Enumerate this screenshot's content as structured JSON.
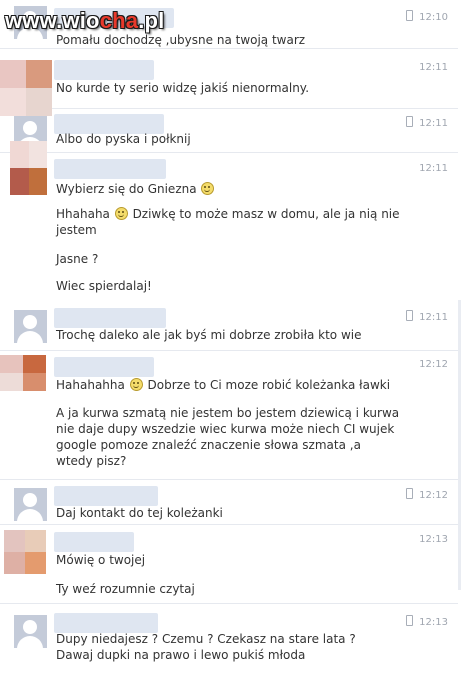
{
  "watermark": {
    "prefix": "www.wio",
    "accent": "cha",
    "suffix": ".pl"
  },
  "messages": [
    {
      "time": "12:10",
      "lines": [
        "Pomału dochodzę ,ubysne na twoją twarz"
      ]
    },
    {
      "time": "12:11",
      "lines": [
        "No kurde ty serio widzę jakiś nienormalny."
      ]
    },
    {
      "time": "12:11",
      "lines": [
        "Albo do pyska i połknij"
      ]
    },
    {
      "time": "12:11",
      "lines": [
        "Wybierz się do Gniezna",
        "Hhahaha",
        "Dziwkę to może masz w domu, ale ja nią nie jestem",
        "Jasne ?",
        "Wiec spierdalaj!"
      ]
    },
    {
      "time": "12:11",
      "lines": [
        "Trochę daleko ale jak byś mi dobrze zrobiła kto wie"
      ]
    },
    {
      "time": "12:12",
      "lines": [
        "Hahahahha",
        "Dobrze to Ci moze robić koleżanka ławki",
        "A ja kurwa szmatą nie jestem bo jestem dziewicą i kurwa nie daje dupy wszedzie wiec kurwa może niech CI wujek google pomoze znaleźć znaczenie słowa szmata ,a wtedy pisz?"
      ]
    },
    {
      "time": "12:12",
      "lines": [
        "Daj kontakt do tej koleżanki"
      ]
    },
    {
      "time": "12:13",
      "lines": [
        "Mówię o twojej",
        "Ty weź rozumnie czytaj"
      ]
    },
    {
      "time": "12:13",
      "lines": [
        "Dupy niedajesz ? Czemu ? Czekasz na stare lata ? Dawaj dupki na prawo i lewo pukiś młoda"
      ]
    }
  ],
  "icons": {
    "smiley": "smiley-icon",
    "phone": "mobile-phone-icon"
  },
  "colors": {
    "separator": "#e6e9ef",
    "text": "#333333",
    "time": "#a0a6b0",
    "avatar_placeholder": "#c4cbd9"
  }
}
